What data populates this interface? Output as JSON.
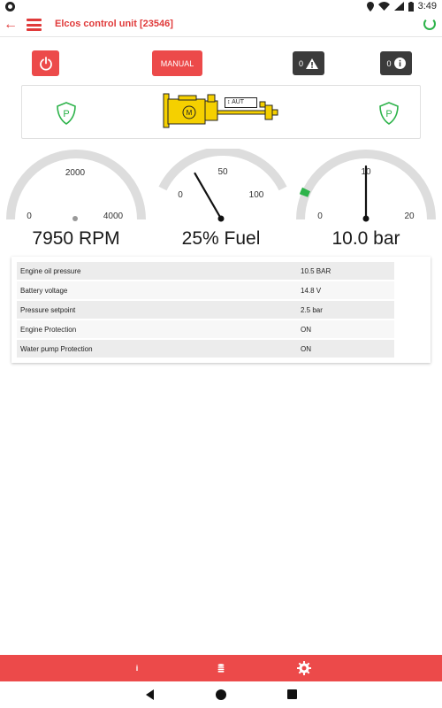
{
  "status_bar": {
    "time": "3:49"
  },
  "app_bar": {
    "title": "Elcos control unit [23546]"
  },
  "controls": {
    "manual_label": "MANUAL",
    "warnings_count": "0",
    "info_count": "0"
  },
  "panel": {
    "mode_label": "AUT"
  },
  "gauges": [
    {
      "name": "rpm",
      "min_label": "0",
      "mid_label": "2000",
      "max_label": "4000",
      "value": 7950,
      "range": [
        0,
        4000
      ],
      "display": "7950 RPM"
    },
    {
      "name": "fuel",
      "min_label": "0",
      "mid_label": "50",
      "max_label": "100",
      "value": 25,
      "range": [
        0,
        100
      ],
      "display": "25% Fuel"
    },
    {
      "name": "pressure",
      "min_label": "0",
      "mid_label": "10",
      "max_label": "20",
      "value": 10.0,
      "range": [
        0,
        20
      ],
      "display": "10.0 bar"
    }
  ],
  "table": {
    "rows": [
      {
        "label": "Engine oil pressure",
        "value": "10.5 BAR"
      },
      {
        "label": "Battery voltage",
        "value": "14.8 V"
      },
      {
        "label": "Pressure setpoint",
        "value": "2.5 bar"
      },
      {
        "label": "Engine Protection",
        "value": "ON"
      },
      {
        "label": "Water pump Protection",
        "value": "ON"
      }
    ]
  },
  "bottom_bar": {
    "info_label": "i"
  },
  "colors": {
    "accent": "#ec4a4a",
    "dark_button": "#3b3b3b",
    "ok_green": "#2db34a",
    "engine_yellow": "#f5d000"
  }
}
